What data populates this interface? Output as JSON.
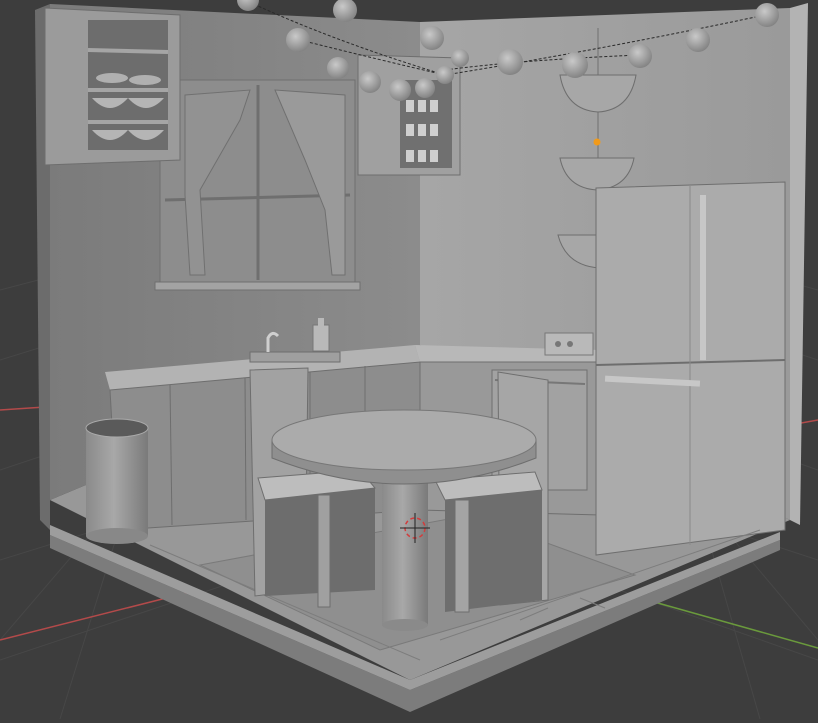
{
  "app": "3D Viewport",
  "scene": {
    "description_visible": "",
    "viewport": {
      "background_color": "#3d3d3d",
      "grid_color": "#454545",
      "x_axis_color": "#b34a4a",
      "y_axis_color": "#6a9a3c",
      "cursor_color": "#d23c3c",
      "origin_color": "#f19a1a"
    },
    "model": {
      "base_color": "#8e8e8e",
      "light_color": "#a9a9a9",
      "shadow_color": "#6a6a6a"
    }
  }
}
